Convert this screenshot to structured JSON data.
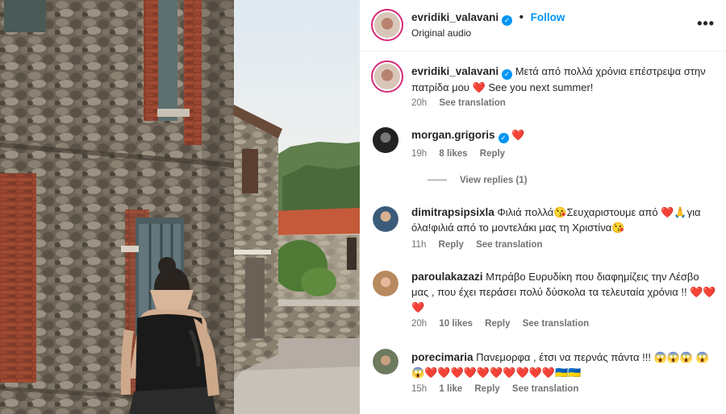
{
  "header": {
    "username": "evridiki_valavani",
    "verified": true,
    "follow_label": "Follow",
    "subtitle": "Original audio",
    "more_icon": "more-horizontal-icon"
  },
  "caption": {
    "username": "evridiki_valavani",
    "text_1": "Μετά από πολλά χρόνια επέστρεψα στην πατρίδα μου",
    "emoji": "❤️",
    "text_2": "See you next summer!",
    "time": "20h",
    "see_translation": "See translation"
  },
  "comments": [
    {
      "username": "morgan.grigoris",
      "verified": true,
      "text": "❤️",
      "time": "19h",
      "likes": "8 likes",
      "reply": "Reply",
      "view_replies": "View replies (1)"
    },
    {
      "username": "dimitrapsipsixla",
      "text": "Φιλιά πολλά😘Σευχαριστουμε από ❤️🙏για όλα!φιλιά από το μοντελάκι μας τη Χριστίνα😘",
      "time": "11h",
      "reply": "Reply",
      "see_translation": "See translation"
    },
    {
      "username": "paroulakazazi",
      "text": "Μπράβο Ευρυδίκη που διαφημίζεις την Λέσβο μας , που έχει περάσει πολύ δύσκολα τα τελευταία χρόνια !! ❤️❤️❤️",
      "time": "20h",
      "likes": "10 likes",
      "reply": "Reply",
      "see_translation": "See translation"
    },
    {
      "username": "porecimaria",
      "text": "Πανεμορφα , έτσι να περνάς πάντα !!! 😱😱😱 😱😱❤️❤️❤️❤️❤️❤️❤️❤️❤️❤️🇺🇦🇺🇦",
      "time": "15h",
      "likes": "1 like",
      "reply": "Reply",
      "see_translation": "See translation"
    }
  ],
  "colors": {
    "accent": "#0095f6",
    "muted": "#737373",
    "text": "#262626",
    "heart": "#e0245e"
  }
}
